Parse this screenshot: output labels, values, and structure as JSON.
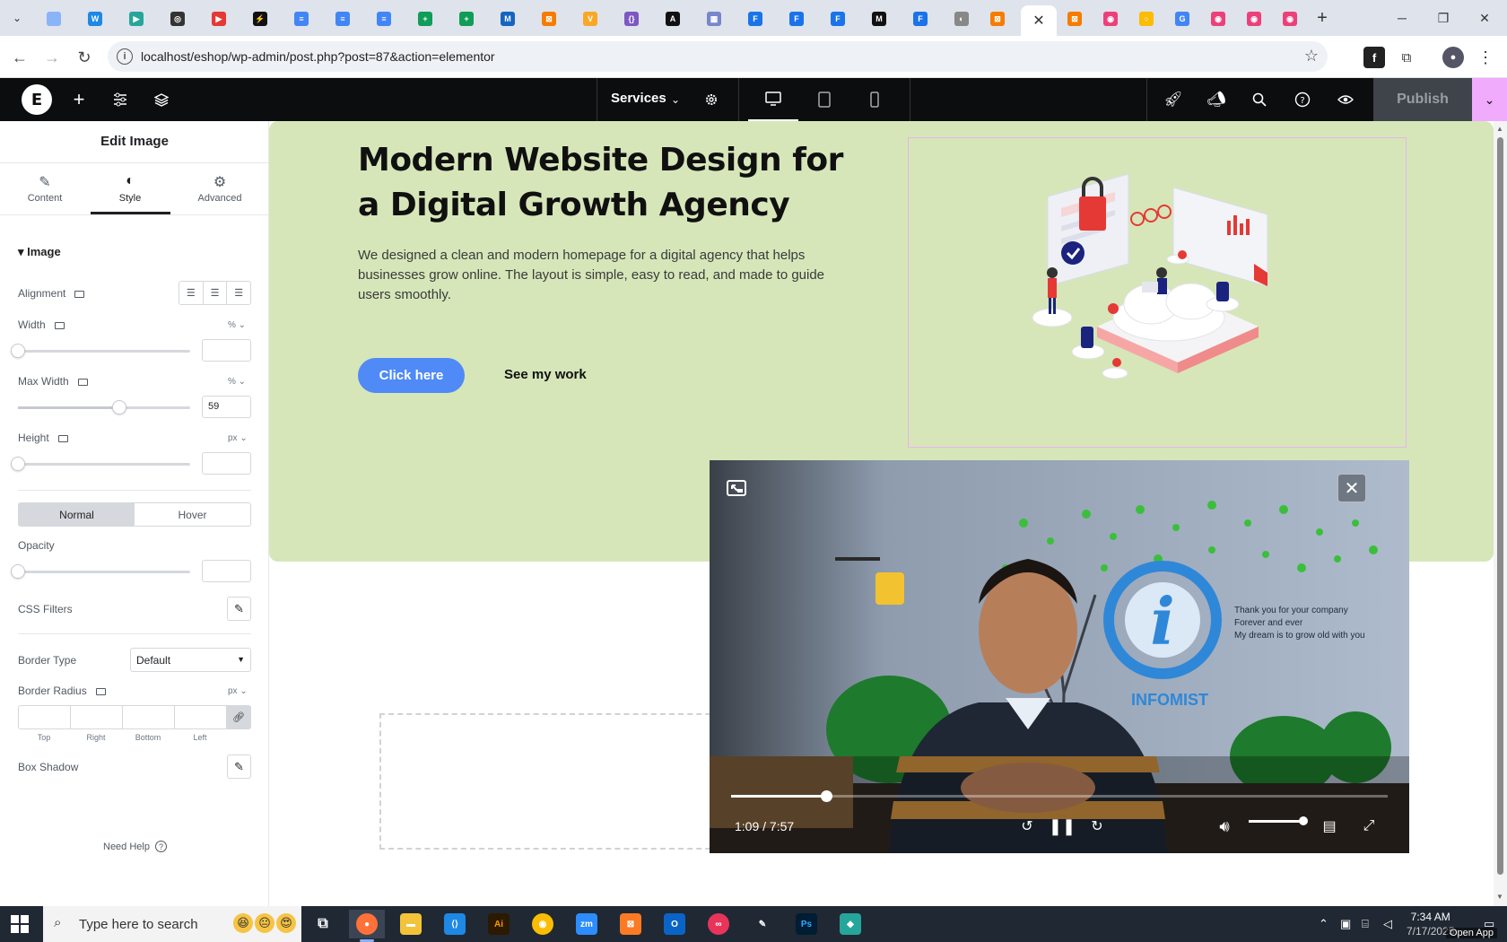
{
  "browser": {
    "tab_icons": [
      {
        "name": "tab-favicon-1",
        "color": "#8ab4f8",
        "glyph": ""
      },
      {
        "name": "tab-favicon-2",
        "color": "#1e88e5",
        "glyph": "W"
      },
      {
        "name": "tab-favicon-3",
        "color": "#26a69a",
        "glyph": "▶"
      },
      {
        "name": "tab-favicon-4",
        "color": "#333333",
        "glyph": "◎"
      },
      {
        "name": "tab-favicon-5",
        "color": "#e53935",
        "glyph": "▶"
      },
      {
        "name": "tab-favicon-6",
        "color": "#111111",
        "glyph": "⚡"
      },
      {
        "name": "tab-favicon-7",
        "color": "#4285f4",
        "glyph": "≡"
      },
      {
        "name": "tab-favicon-8",
        "color": "#4285f4",
        "glyph": "≡"
      },
      {
        "name": "tab-favicon-9",
        "color": "#4285f4",
        "glyph": "≡"
      },
      {
        "name": "tab-favicon-10",
        "color": "#0f9d58",
        "glyph": "+"
      },
      {
        "name": "tab-favicon-11",
        "color": "#0f9d58",
        "glyph": "+"
      },
      {
        "name": "tab-favicon-12",
        "color": "#1565c0",
        "glyph": "M"
      },
      {
        "name": "tab-favicon-13",
        "color": "#f57c00",
        "glyph": "⊠"
      },
      {
        "name": "tab-favicon-14",
        "color": "#f9a825",
        "glyph": "V"
      },
      {
        "name": "tab-favicon-15",
        "color": "#7e57c2",
        "glyph": "{}"
      },
      {
        "name": "tab-favicon-16",
        "color": "#111111",
        "glyph": "A"
      },
      {
        "name": "tab-favicon-17",
        "color": "#7986cb",
        "glyph": "▦"
      },
      {
        "name": "tab-favicon-18",
        "color": "#1a73e8",
        "glyph": "F"
      },
      {
        "name": "tab-favicon-19",
        "color": "#1a73e8",
        "glyph": "F"
      },
      {
        "name": "tab-favicon-20",
        "color": "#1a73e8",
        "glyph": "F"
      },
      {
        "name": "tab-favicon-21",
        "color": "#111111",
        "glyph": "M"
      },
      {
        "name": "tab-favicon-22",
        "color": "#1a73e8",
        "glyph": "F"
      },
      {
        "name": "tab-favicon-23",
        "color": "#888888",
        "glyph": "◐"
      },
      {
        "name": "tab-favicon-24",
        "color": "#f57c00",
        "glyph": "⊠"
      },
      {
        "name": "tab-favicon-25",
        "color": "#f57c00",
        "glyph": "⊠"
      },
      {
        "name": "tab-favicon-26",
        "color": "#ec407a",
        "glyph": "◉"
      },
      {
        "name": "tab-favicon-27",
        "color": "#fbbc04",
        "glyph": "○"
      },
      {
        "name": "tab-favicon-28",
        "color": "#4285f4",
        "glyph": "G"
      },
      {
        "name": "tab-favicon-29",
        "color": "#ec407a",
        "glyph": "◉"
      },
      {
        "name": "tab-favicon-30",
        "color": "#ec407a",
        "glyph": "◉"
      },
      {
        "name": "tab-favicon-31",
        "color": "#ec407a",
        "glyph": "◉"
      }
    ],
    "active_tab_close": "✕",
    "url": "localhost/eshop/wp-admin/post.php?post=87&action=elementor"
  },
  "elementor_top": {
    "page_name": "Services",
    "publish_label": "Publish",
    "accent_color": "#f0abfc"
  },
  "panel": {
    "title": "Edit Image",
    "tabs": [
      {
        "label": "Content",
        "icon": "pencil-icon"
      },
      {
        "label": "Style",
        "icon": "contrast-icon"
      },
      {
        "label": "Advanced",
        "icon": "gear-icon"
      }
    ],
    "active_tab": "Style",
    "section": "Image",
    "alignment_label": "Alignment",
    "width_label": "Width",
    "width_unit": "%",
    "width_value": "",
    "max_width_label": "Max Width",
    "max_width_unit": "%",
    "max_width_value": "59",
    "height_label": "Height",
    "height_unit": "px",
    "height_value": "",
    "state_normal": "Normal",
    "state_hover": "Hover",
    "opacity_label": "Opacity",
    "opacity_value": "",
    "css_filters_label": "CSS Filters",
    "border_type_label": "Border Type",
    "border_type_value": "Default",
    "border_radius_label": "Border Radius",
    "border_radius_unit": "px",
    "radius_labels": [
      "Top",
      "Right",
      "Bottom",
      "Left"
    ],
    "box_shadow_label": "Box Shadow",
    "need_help": "Need Help"
  },
  "hero": {
    "heading": "Modern Website Design for a Digital Growth Agency",
    "paragraph": "We designed a clean and modern homepage for a digital agency that helps businesses grow online. The layout is simple, easy to read, and made to guide users smoothly.",
    "primary_button": "Click here",
    "secondary_button": "See my work",
    "background_color": "#d6e6b9",
    "button_color": "#4f8af7"
  },
  "video": {
    "current_time": "1:09",
    "duration": "7:57",
    "time_display": "1:09 / 7:57",
    "progress": 0.145,
    "volume": 0.93,
    "wall_text": [
      "Thank you for your company",
      "Forever and ever",
      "My dream is to grow old with you"
    ],
    "logo_text": "INFOMIST"
  },
  "taskbar": {
    "search_placeholder": "Type here to search",
    "time": "7:34 AM",
    "date": "7/17/2025",
    "open_app": "Open App"
  }
}
